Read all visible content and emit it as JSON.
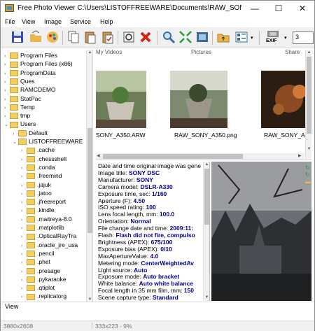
{
  "window": {
    "title": "Free Photo Viewer C:\\Users\\LISTOFFREEWARE\\Documents\\RAW_SONY_A330",
    "minimize_glyph": "—",
    "maximize_glyph": "☐",
    "close_glyph": "✕"
  },
  "menu": [
    "File",
    "View",
    "Image",
    "Service",
    "Help"
  ],
  "toolbar": {
    "icons": [
      "save-icon",
      "open-folder-icon",
      "paint-icon",
      "copy-icon",
      "paste-icon",
      "paste-special-icon",
      "crop-icon",
      "delete-icon",
      "zoom-icon",
      "fit-icon",
      "filmstrip-icon",
      "folder-up-icon",
      "grid-view-icon",
      "exif-icon"
    ],
    "exif_label": "EXIF",
    "combo_value": "3"
  },
  "tree": {
    "items": [
      {
        "label": "Program Files",
        "indent": 0
      },
      {
        "label": "Program Files (x86)",
        "indent": 0
      },
      {
        "label": "ProgramData",
        "indent": 0
      },
      {
        "label": "Ques",
        "indent": 0
      },
      {
        "label": "RAMCDEMO",
        "indent": 0
      },
      {
        "label": "StatPac",
        "indent": 0
      },
      {
        "label": "Temp",
        "indent": 0
      },
      {
        "label": "tmp",
        "indent": 0
      },
      {
        "label": "Users",
        "indent": 0
      },
      {
        "label": "Default",
        "indent": 1
      },
      {
        "label": "LISTOFFREEWARE",
        "indent": 1
      },
      {
        "label": ".cache",
        "indent": 2
      },
      {
        "label": ".chessshell",
        "indent": 2
      },
      {
        "label": ".conda",
        "indent": 2
      },
      {
        "label": ".freemind",
        "indent": 2
      },
      {
        "label": ".jajuk",
        "indent": 2
      },
      {
        "label": ".jatoo",
        "indent": 2
      },
      {
        "label": ".jfreereport",
        "indent": 2
      },
      {
        "label": ".kindle",
        "indent": 2
      },
      {
        "label": ".maitreya-8.0",
        "indent": 2
      },
      {
        "label": ".matplotlib",
        "indent": 2
      },
      {
        "label": ".OpticalRayTra",
        "indent": 2
      },
      {
        "label": ".oracle_jre_usa",
        "indent": 2
      },
      {
        "label": ".pencil",
        "indent": 2
      },
      {
        "label": ".phet",
        "indent": 2
      },
      {
        "label": ".presage",
        "indent": 2
      },
      {
        "label": ".pykaraoke",
        "indent": 2
      },
      {
        "label": ".qtiplot",
        "indent": 2
      },
      {
        "label": ".replicatorg",
        "indent": 2
      }
    ]
  },
  "thumbnails": {
    "header_labels": [
      "My Videos",
      "Pictures",
      "Share"
    ],
    "items": [
      {
        "name": "SONY_A350.ARW"
      },
      {
        "name": "RAW_SONY_A350.png"
      },
      {
        "name": "RAW_SONY_A350.jpg"
      }
    ]
  },
  "info": [
    {
      "label": "Date and time original image was gene",
      "value": ""
    },
    {
      "label": "Image title: ",
      "value": "SONY DSC"
    },
    {
      "label": "Manufacturer: ",
      "value": "SONY"
    },
    {
      "label": "Camera model: ",
      "value": "DSLR-A330"
    },
    {
      "label": "Exposure time, sec: ",
      "value": "1/160"
    },
    {
      "label": "Aperture (F): ",
      "value": "4.50"
    },
    {
      "label": "ISO speed rating: ",
      "value": "100"
    },
    {
      "label": "Lens focal length, mm: ",
      "value": "100.0"
    },
    {
      "label": "Orientation: ",
      "value": "Normal"
    },
    {
      "label": "File change date and time: ",
      "value": "2009:11:"
    },
    {
      "label": "Flash: ",
      "value": "Flash did not fire, compulso"
    },
    {
      "label": "Brightness (APEX): ",
      "value": "675/100"
    },
    {
      "label": "Exposure bias (APEX): ",
      "value": "0/10"
    },
    {
      "label": "MaxApertureValue: ",
      "value": "4.0"
    },
    {
      "label": "Metering mode: ",
      "value": "CenterWeightedAv"
    },
    {
      "label": "Light source: ",
      "value": "Auto"
    },
    {
      "label": "Exposure mode: ",
      "value": "Auto bracket"
    },
    {
      "label": "White balance: ",
      "value": "Auto white balance"
    },
    {
      "label": "Focal length in 35 mm film, mm: ",
      "value": "150"
    },
    {
      "label": "Scene capture type: ",
      "value": "Standard"
    }
  ],
  "tabs": {
    "view": "View"
  },
  "status": {
    "resolution": "3880x2608",
    "preview_info": "333x223 - 9%"
  },
  "colors": {
    "accent_value": "#00008b",
    "folder": "#f3cf63",
    "delete_red": "#d0271d"
  }
}
